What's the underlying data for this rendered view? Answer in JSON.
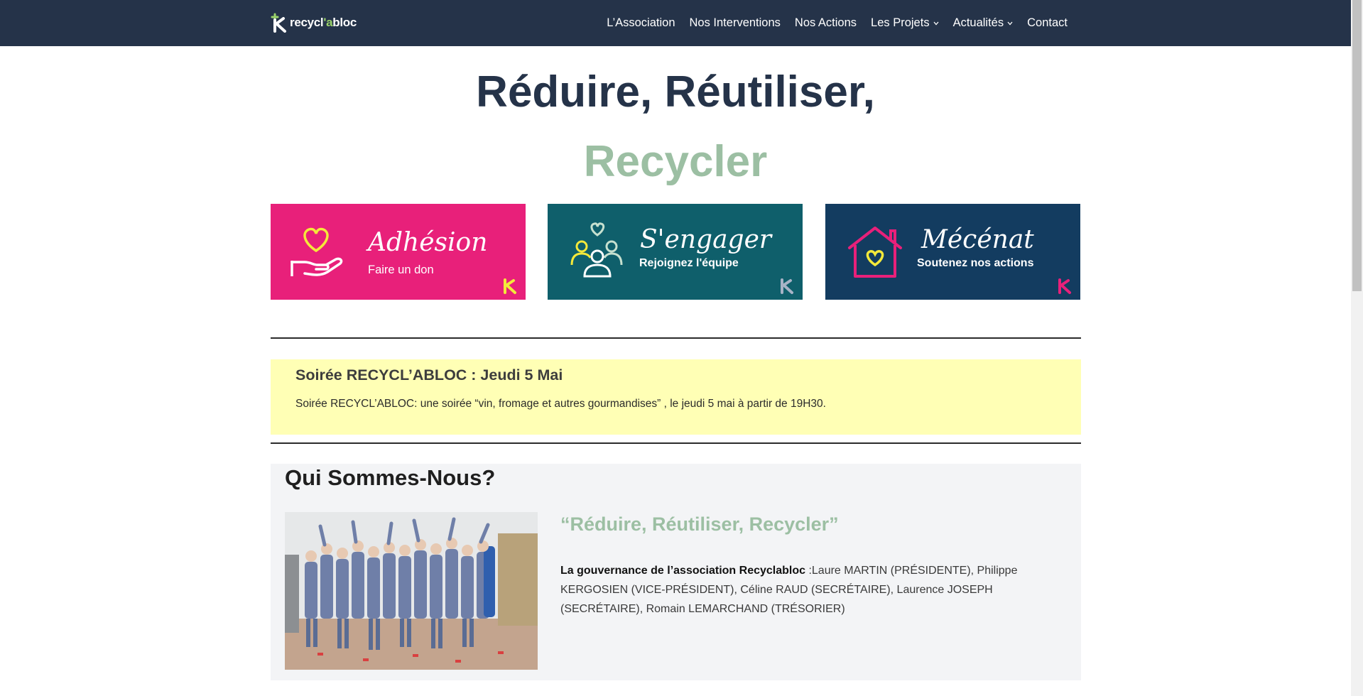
{
  "header": {
    "logo": {
      "prefix": "recycl",
      "apostrophe": "'a",
      "suffix": "bloc"
    },
    "nav": [
      {
        "label": "L’Association",
        "dropdown": false
      },
      {
        "label": "Nos Interventions",
        "dropdown": false
      },
      {
        "label": "Nos Actions",
        "dropdown": false
      },
      {
        "label": "Les Projets",
        "dropdown": true
      },
      {
        "label": "Actualités",
        "dropdown": true
      },
      {
        "label": "Contact",
        "dropdown": false
      }
    ]
  },
  "hero": {
    "line1": "Réduire, Réutiliser,",
    "line2": "Recycler"
  },
  "cards": [
    {
      "title": "Adhésion",
      "subtitle": "Faire un don",
      "icon": "heart-hand-icon",
      "color": "#e8207a"
    },
    {
      "title": "S'engager",
      "subtitle": "Rejoignez l'équipe",
      "icon": "team-heart-icon",
      "color": "#0f5f6b"
    },
    {
      "title": "Mécénat",
      "subtitle": "Soutenez nos actions",
      "icon": "house-heart-icon",
      "color": "#133c60"
    }
  ],
  "event": {
    "title": "Soirée RECYCL’ABLOC : Jeudi 5 Mai",
    "text": "Soirée RECYCL’ABLOC: une soirée “vin, fromage et autres gourmandises” , le jeudi 5 mai à partir de 19H30."
  },
  "about": {
    "title": "Qui Sommes-Nous?",
    "quote": "“Réduire, Réutiliser, Recycler”",
    "gov_label": "La gouvernance de l’association Recyclabloc",
    "gov_text": " :Laure MARTIN (PRÉSIDENTE), Philippe KERGOSIEN (VICE-PRÉSIDENT), Céline RAUD (SECRÉTAIRE), Laurence JOSEPH (SECRÉTAIRE), Romain LEMARCHAND (TRÉSORIER)"
  },
  "colors": {
    "navy": "#253349",
    "sage": "#9cbfa3",
    "pink": "#e8207a",
    "teal": "#0f5f6b",
    "blue": "#133c60",
    "yellow": "#ffffb5"
  }
}
